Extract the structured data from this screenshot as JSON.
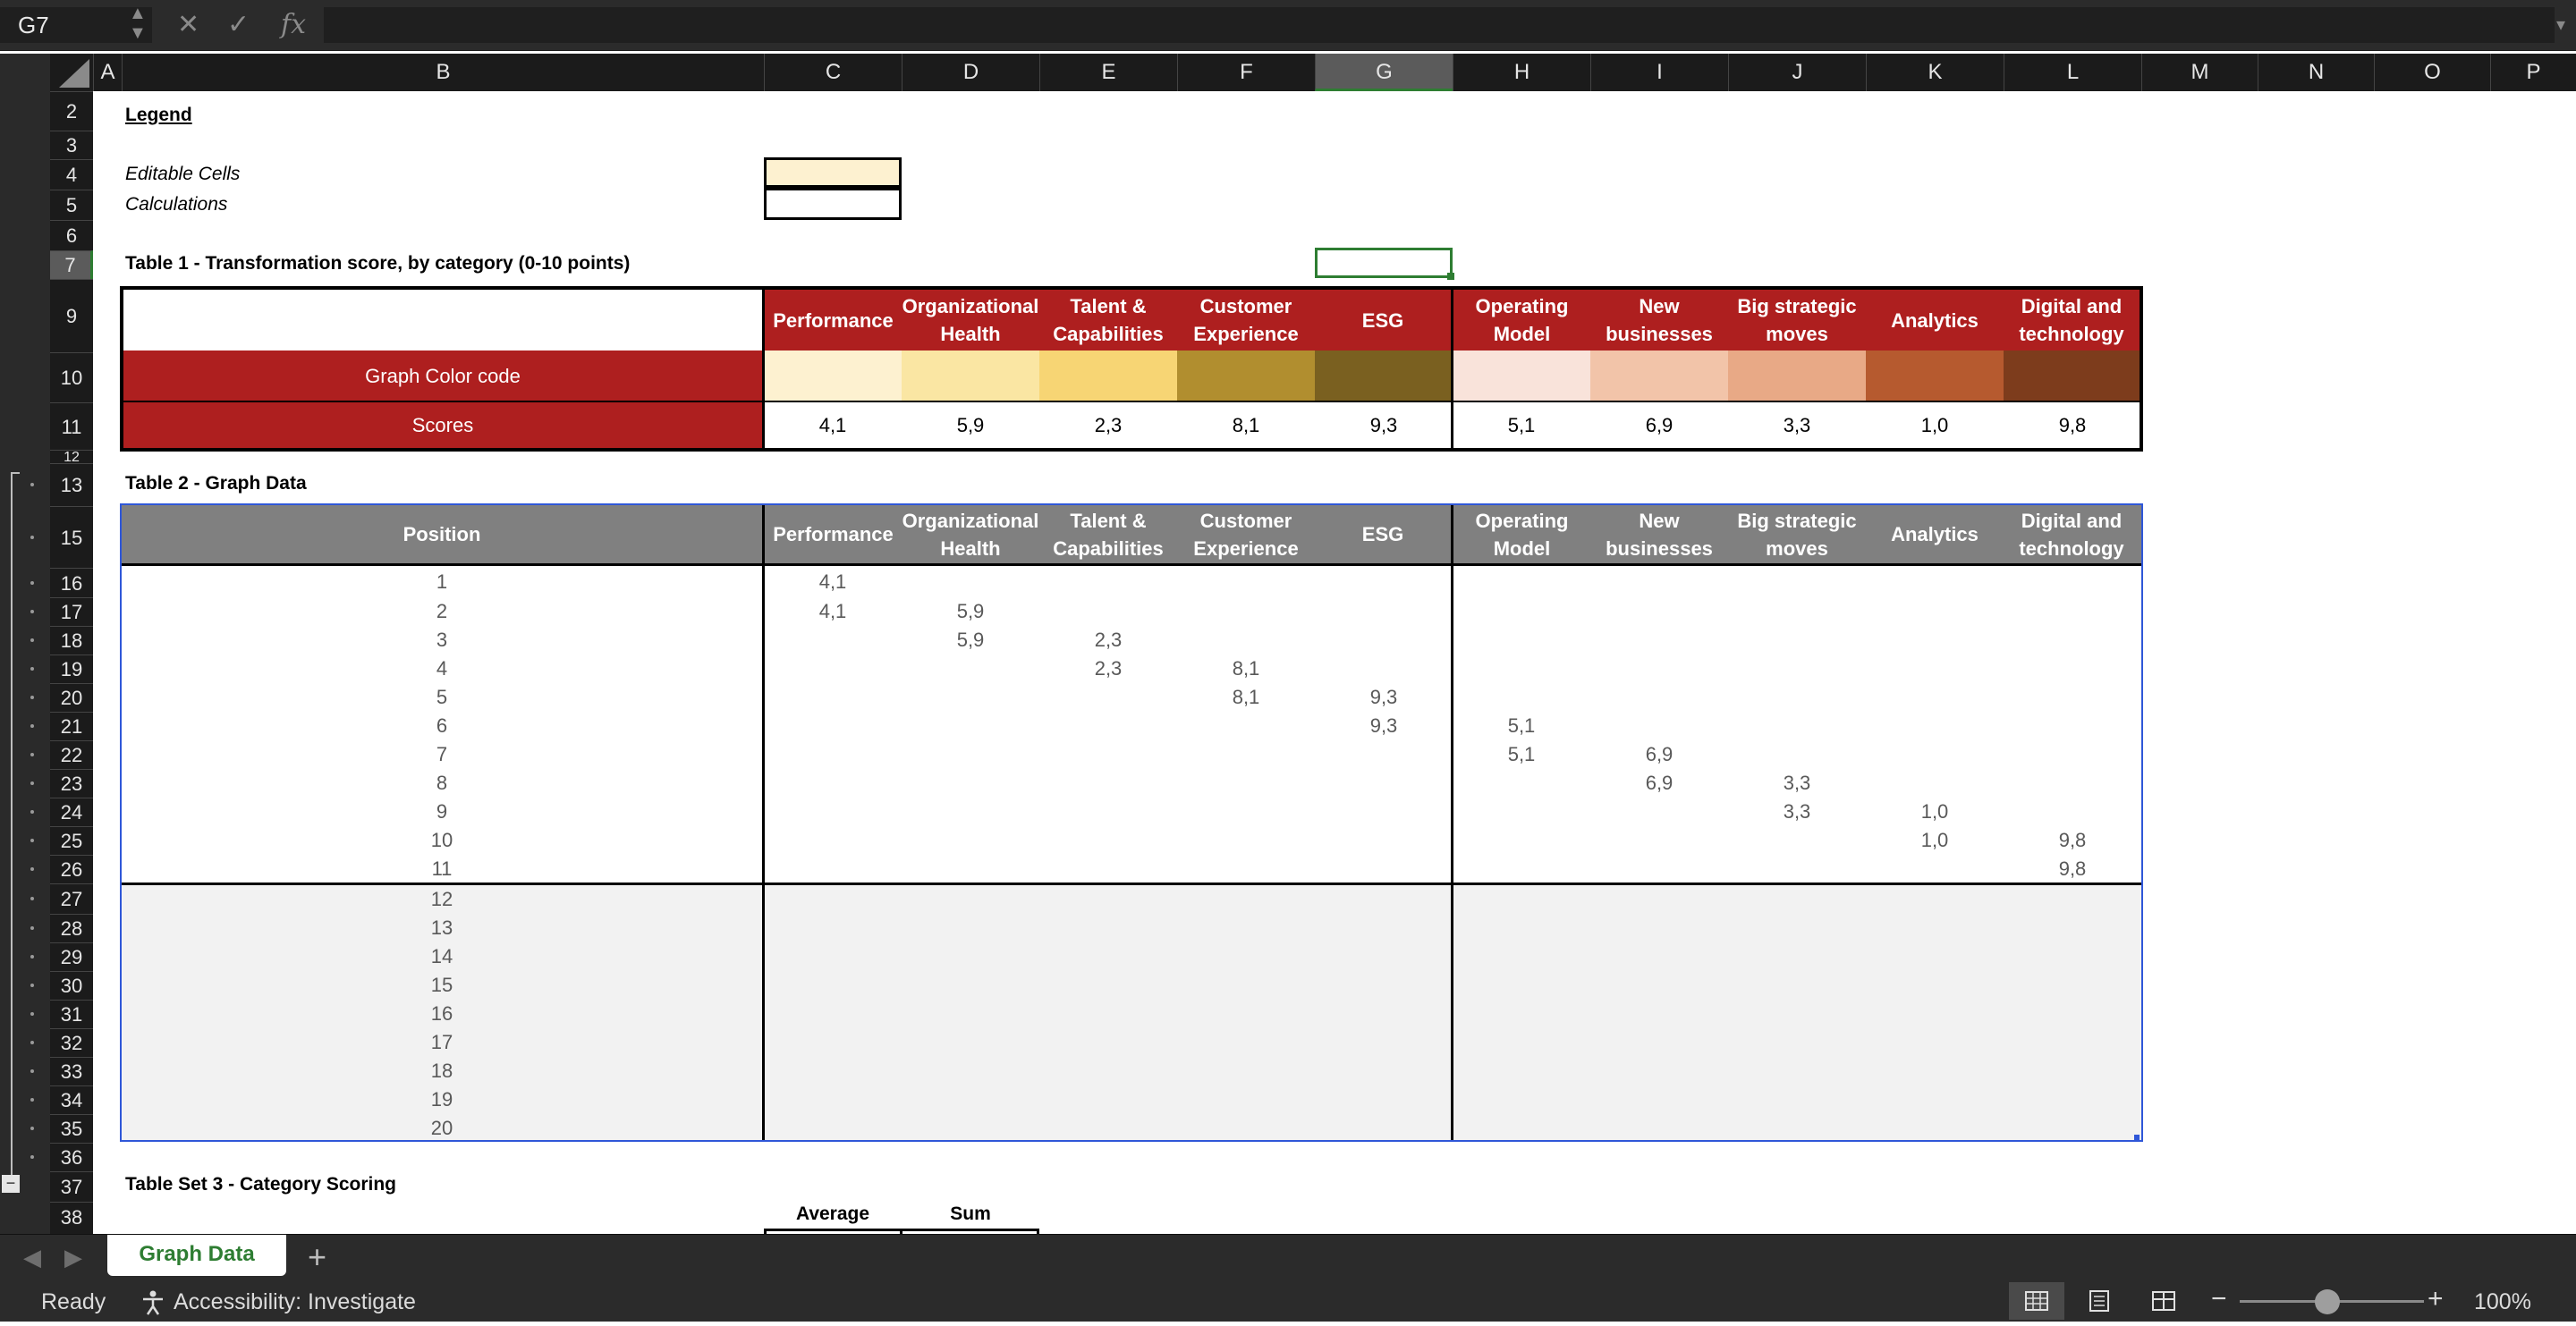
{
  "formula_bar": {
    "name_box": "G7",
    "fx": "fx"
  },
  "columns": [
    "A",
    "B",
    "C",
    "D",
    "E",
    "F",
    "G",
    "H",
    "I",
    "J",
    "K",
    "L",
    "M",
    "N",
    "O",
    "P"
  ],
  "outline_levels": [
    "1",
    "2"
  ],
  "rows": [
    "2",
    "3",
    "4",
    "5",
    "6",
    "7",
    "9",
    "10",
    "11",
    "12",
    "13",
    "15",
    "16",
    "17",
    "18",
    "19",
    "20",
    "21",
    "22",
    "23",
    "24",
    "25",
    "26",
    "27",
    "28",
    "29",
    "30",
    "31",
    "32",
    "33",
    "34",
    "35",
    "36",
    "37",
    "38"
  ],
  "legend": {
    "title": "Legend",
    "editable": "Editable Cells",
    "calculations": "Calculations"
  },
  "table1": {
    "title": "Table 1 - Transformation score, by category (0-10 points)",
    "headers": [
      "Performance",
      "Organizational Health",
      "Talent & Capabilities",
      "Customer Experience",
      "ESG",
      "Operating Model",
      "New businesses",
      "Big strategic moves",
      "Analytics",
      "Digital and technology"
    ],
    "row_color_label": "Graph Color code",
    "row_scores_label": "Scores",
    "scores": [
      "4,1",
      "5,9",
      "2,3",
      "8,1",
      "9,3",
      "5,1",
      "6,9",
      "3,3",
      "1,0",
      "9,8"
    ],
    "colors": [
      "#fdf1d0",
      "#fae6a3",
      "#f7d574",
      "#b18e2f",
      "#7a6020",
      "#f9e3da",
      "#f2c4a9",
      "#e8a986",
      "#b65a2f",
      "#7d3c1c"
    ]
  },
  "table2": {
    "title": "Table 2 - Graph Data",
    "position_header": "Position",
    "positions": [
      "1",
      "2",
      "3",
      "4",
      "5",
      "6",
      "7",
      "8",
      "9",
      "10",
      "11",
      "12",
      "13",
      "14",
      "15",
      "16",
      "17",
      "18",
      "19",
      "20"
    ],
    "values": [
      [
        "4,1",
        "",
        "",
        "",
        "",
        "",
        "",
        "",
        "",
        ""
      ],
      [
        "4,1",
        "5,9",
        "",
        "",
        "",
        "",
        "",
        "",
        "",
        ""
      ],
      [
        "",
        "5,9",
        "2,3",
        "",
        "",
        "",
        "",
        "",
        "",
        ""
      ],
      [
        "",
        "",
        "2,3",
        "8,1",
        "",
        "",
        "",
        "",
        "",
        ""
      ],
      [
        "",
        "",
        "",
        "8,1",
        "9,3",
        "",
        "",
        "",
        "",
        ""
      ],
      [
        "",
        "",
        "",
        "",
        "9,3",
        "5,1",
        "",
        "",
        "",
        ""
      ],
      [
        "",
        "",
        "",
        "",
        "",
        "5,1",
        "6,9",
        "",
        "",
        ""
      ],
      [
        "",
        "",
        "",
        "",
        "",
        "",
        "6,9",
        "3,3",
        "",
        ""
      ],
      [
        "",
        "",
        "",
        "",
        "",
        "",
        "",
        "3,3",
        "1,0",
        ""
      ],
      [
        "",
        "",
        "",
        "",
        "",
        "",
        "",
        "",
        "1,0",
        "9,8"
      ],
      [
        "",
        "",
        "",
        "",
        "",
        "",
        "",
        "",
        "",
        "9,8"
      ]
    ]
  },
  "table3": {
    "title": "Table Set 3 - Category Scoring",
    "col_average": "Average",
    "col_sum": "Sum"
  },
  "sheet_tabs": [
    {
      "label": "Graph Data",
      "active": true
    }
  ],
  "status": {
    "ready": "Ready",
    "accessibility": "Accessibility: Investigate",
    "zoom": "100%",
    "zoom_minus": "−",
    "zoom_plus": "+"
  },
  "colors": {
    "accent_red": "#ae1f1f",
    "header_gray": "#808080",
    "selection_green": "#2e7d32",
    "table2_border": "#2f57d8"
  }
}
